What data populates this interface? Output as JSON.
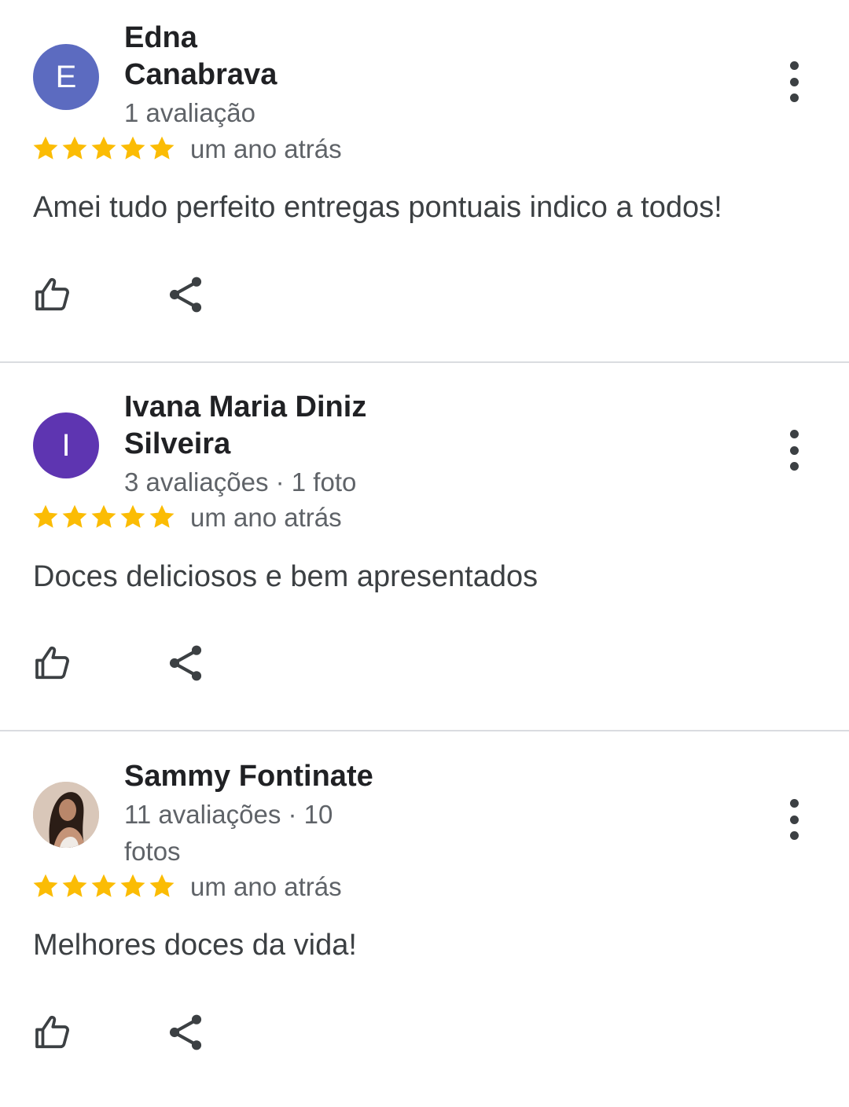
{
  "colors": {
    "star": "#fbbc04",
    "avatar_e": "#5c6bc0",
    "avatar_i": "#5e35b1",
    "divider": "#dadce0",
    "secondary_text": "#5f6368"
  },
  "icons": {
    "rating": "star-icon",
    "more": "more-vert-icon",
    "like": "thumb-up-outline-icon",
    "share": "share-icon"
  },
  "reviews": [
    {
      "avatar_letter": "E",
      "name_line1": "Edna",
      "name_line2": "Canabrava",
      "meta_line1": "1 avaliação",
      "meta_line2": "",
      "rating": 5,
      "date": "um ano atrás",
      "text": "Amei tudo perfeito entregas pontuais indico a todos!"
    },
    {
      "avatar_letter": "I",
      "name_line1": "Ivana Maria Diniz",
      "name_line2": "Silveira",
      "meta_line1": "3 avaliações · 1 foto",
      "meta_line2": "",
      "rating": 5,
      "date": "um ano atrás",
      "text": "Doces deliciosos e bem apresentados"
    },
    {
      "avatar_letter": "",
      "name_line1": "Sammy Fontinate",
      "name_line2": "",
      "meta_line1": "11 avaliações · 10",
      "meta_line2": "fotos",
      "rating": 5,
      "date": "um ano atrás",
      "text": "Melhores doces da vida!"
    }
  ]
}
